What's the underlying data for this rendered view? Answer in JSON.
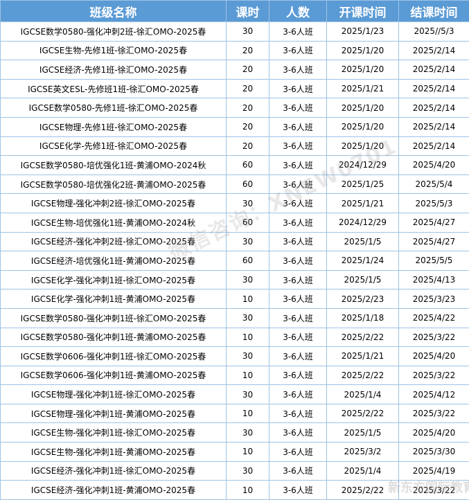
{
  "table": {
    "headers": [
      "班级名称",
      "课时",
      "人数",
      "开课时间",
      "结课时间"
    ],
    "rows": [
      [
        "IGCSE数学0580-强化冲刺2班-徐汇OMO-2025春",
        "30",
        "3-6人班",
        "2025/1/23",
        "2025//5/3"
      ],
      [
        "IGCSE生物-先修1班-徐汇OMO-2025春",
        "20",
        "3-6人班",
        "2025/1/20",
        "2025/2/14"
      ],
      [
        "IGCSE经济-先修1班-徐汇OMO-2025春",
        "20",
        "3-6人班",
        "2025/1/20",
        "2025/2/14"
      ],
      [
        "IGCSE英文ESL-先修班1班-徐汇OMO-2025春",
        "20",
        "3-6人班",
        "2025/1/21",
        "2025/2/14"
      ],
      [
        "IGCSE数学0580-先修1班-徐汇OMO-2025春",
        "20",
        "3-6人班",
        "2025/1/20",
        "2025/2/14"
      ],
      [
        "IGCSE物理-先修1班-徐汇OMO-2025春",
        "20",
        "3-6人班",
        "2025/1/20",
        "2025/2/14"
      ],
      [
        "IGCSE化学-先修1班-徐汇OMO-2025春",
        "20",
        "3-6人班",
        "2025/1/20",
        "2025/2/14"
      ],
      [
        "IGCSE数学0580-培优强化1班-黄浦OMO-2024秋",
        "60",
        "3-6人班",
        "2024/12/29",
        "2025/4/20"
      ],
      [
        "IGCSE数学0580-培优强化2班-黄浦OMO-2025春",
        "60",
        "3-6人班",
        "2025/1/25",
        "2025/5/4"
      ],
      [
        "IGCSE物理-强化冲刺2班-徐汇OMO-2025春",
        "30",
        "3-6人班",
        "2025/1/21",
        "2025/5/3"
      ],
      [
        "IGCSE生物-培优强化1班-黄浦OMO-2024秋",
        "60",
        "3-6人班",
        "2024/12/29",
        "2025/4/27"
      ],
      [
        "IGCSE经济-强化冲刺2班-徐汇OMO-2025春",
        "30",
        "3-6人班",
        "2025/1/5",
        "2025/4/27"
      ],
      [
        "IGCSE经济-培优强化1班-黄浦OMO-2025春",
        "60",
        "3-6人班",
        "2025/1/24",
        "2025/5/5"
      ],
      [
        "IGCSE化学-强化冲刺1班-徐汇OMO-2025春",
        "30",
        "3-6人班",
        "2025/1/5",
        "2025/4/13"
      ],
      [
        "IGCSE化学-强化冲刺1班-黄浦OMO-2025春",
        "10",
        "3-6人班",
        "2025/2/23",
        "2025/3/23"
      ],
      [
        "IGCSE数学0580-强化冲刺1班-徐汇OMO-2025春",
        "30",
        "3-6人班",
        "2025/1/18",
        "2025/4/22"
      ],
      [
        "IGCSE数学0580-强化冲刺1班-黄浦OMO-2025春",
        "10",
        "3-6人班",
        "2025/2/22",
        "2025/3/22"
      ],
      [
        "IGCSE数学0606-强化冲刺1班-徐汇OMO-2025春",
        "30",
        "3-6人班",
        "2025/1/21",
        "2025/4/20"
      ],
      [
        "IGCSE数学0606-强化冲刺1班-黄浦OMO-2025春",
        "10",
        "3-6人班",
        "2025/2/22",
        "2025/3/22"
      ],
      [
        "IGCSE物理-强化冲刺1班-徐汇OMO-2025春",
        "30",
        "3-6人班",
        "2025/1/4",
        "2025/4/12"
      ],
      [
        "IGCSE物理-强化冲刺1班-黄浦OMO-2025春",
        "10",
        "3-6人班",
        "2025/2/22",
        "2025/3/22"
      ],
      [
        "IGCSE生物-强化冲刺1班-徐汇OMO-2025春",
        "30",
        "3-6人班",
        "2025/1/5",
        "2025/4/20"
      ],
      [
        "IGCSE生物-强化冲刺1班-黄浦OMO-2025春",
        "10",
        "3-6人班",
        "2025/3/2",
        "2025/3/30"
      ],
      [
        "IGCSE经济-强化冲刺1班-徐汇OMO-2025春",
        "30",
        "3-6人班",
        "2025/1/4",
        "2025/4/19"
      ],
      [
        "IGCSE经济-强化冲刺1班-黄浦OMO-2025春",
        "10",
        "3-6人班",
        "2025/2/22",
        "2025/3/22"
      ]
    ]
  },
  "watermark": {
    "text": "微信咨询：XNEW0701",
    "corner_text": "新东方国际教育"
  }
}
